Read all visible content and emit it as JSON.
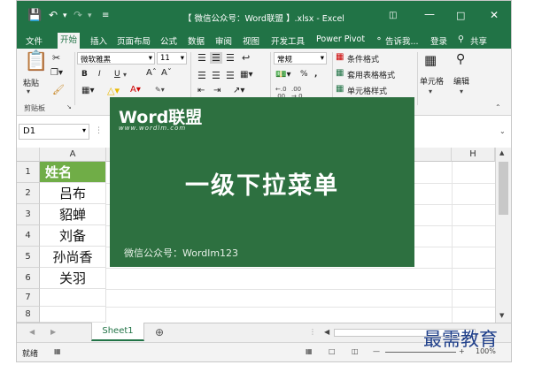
{
  "window": {
    "title": "【 微信公众号：Word联盟 】.xlsx - Excel"
  },
  "quick_access": {
    "save_icon": "save-icon",
    "undo_icon": "undo-icon",
    "redo_icon": "redo-icon",
    "customize_icon": "customize-icon"
  },
  "menu": {
    "items": [
      "文件",
      "开始",
      "插入",
      "页面布局",
      "公式",
      "数据",
      "审阅",
      "视图",
      "开发工具",
      "Power Pivot"
    ],
    "tell_me": "告诉我...",
    "login": "登录",
    "share": "共享"
  },
  "ribbon": {
    "paste": "粘贴",
    "clipboard_group": "剪贴板",
    "font_name": "微软雅黑",
    "font_size": "11",
    "bold": "B",
    "italic": "I",
    "underline": "U",
    "number_format": "常规",
    "conditional_format": "条件格式",
    "table_format": "套用表格格式",
    "cell_style": "单元格样式",
    "cells": "单元格",
    "editing": "编辑"
  },
  "formula_bar": {
    "name_box": "D1"
  },
  "sheet": {
    "columns": [
      "A",
      "H"
    ],
    "rows": [
      "1",
      "2",
      "3",
      "4",
      "5",
      "6",
      "7",
      "8"
    ],
    "cells": [
      "姓名",
      "吕布",
      "貂蝉",
      "刘备",
      "孙尚香",
      "关羽"
    ]
  },
  "sheet_tabs": {
    "active": "Sheet1"
  },
  "status": {
    "ready": "就绪",
    "zoom": "100%"
  },
  "overlay": {
    "logo": "Word联盟",
    "url": "www.wordlm.com",
    "headline": "一级下拉菜单",
    "wechat": "微信公众号：Wordlm123"
  },
  "watermark": {
    "brand": "最需教育"
  },
  "colors": {
    "excel_green": "#217346",
    "overlay_green": "#2d7040",
    "header_green": "#70ad47",
    "brand_blue": "#1f3f8a"
  }
}
